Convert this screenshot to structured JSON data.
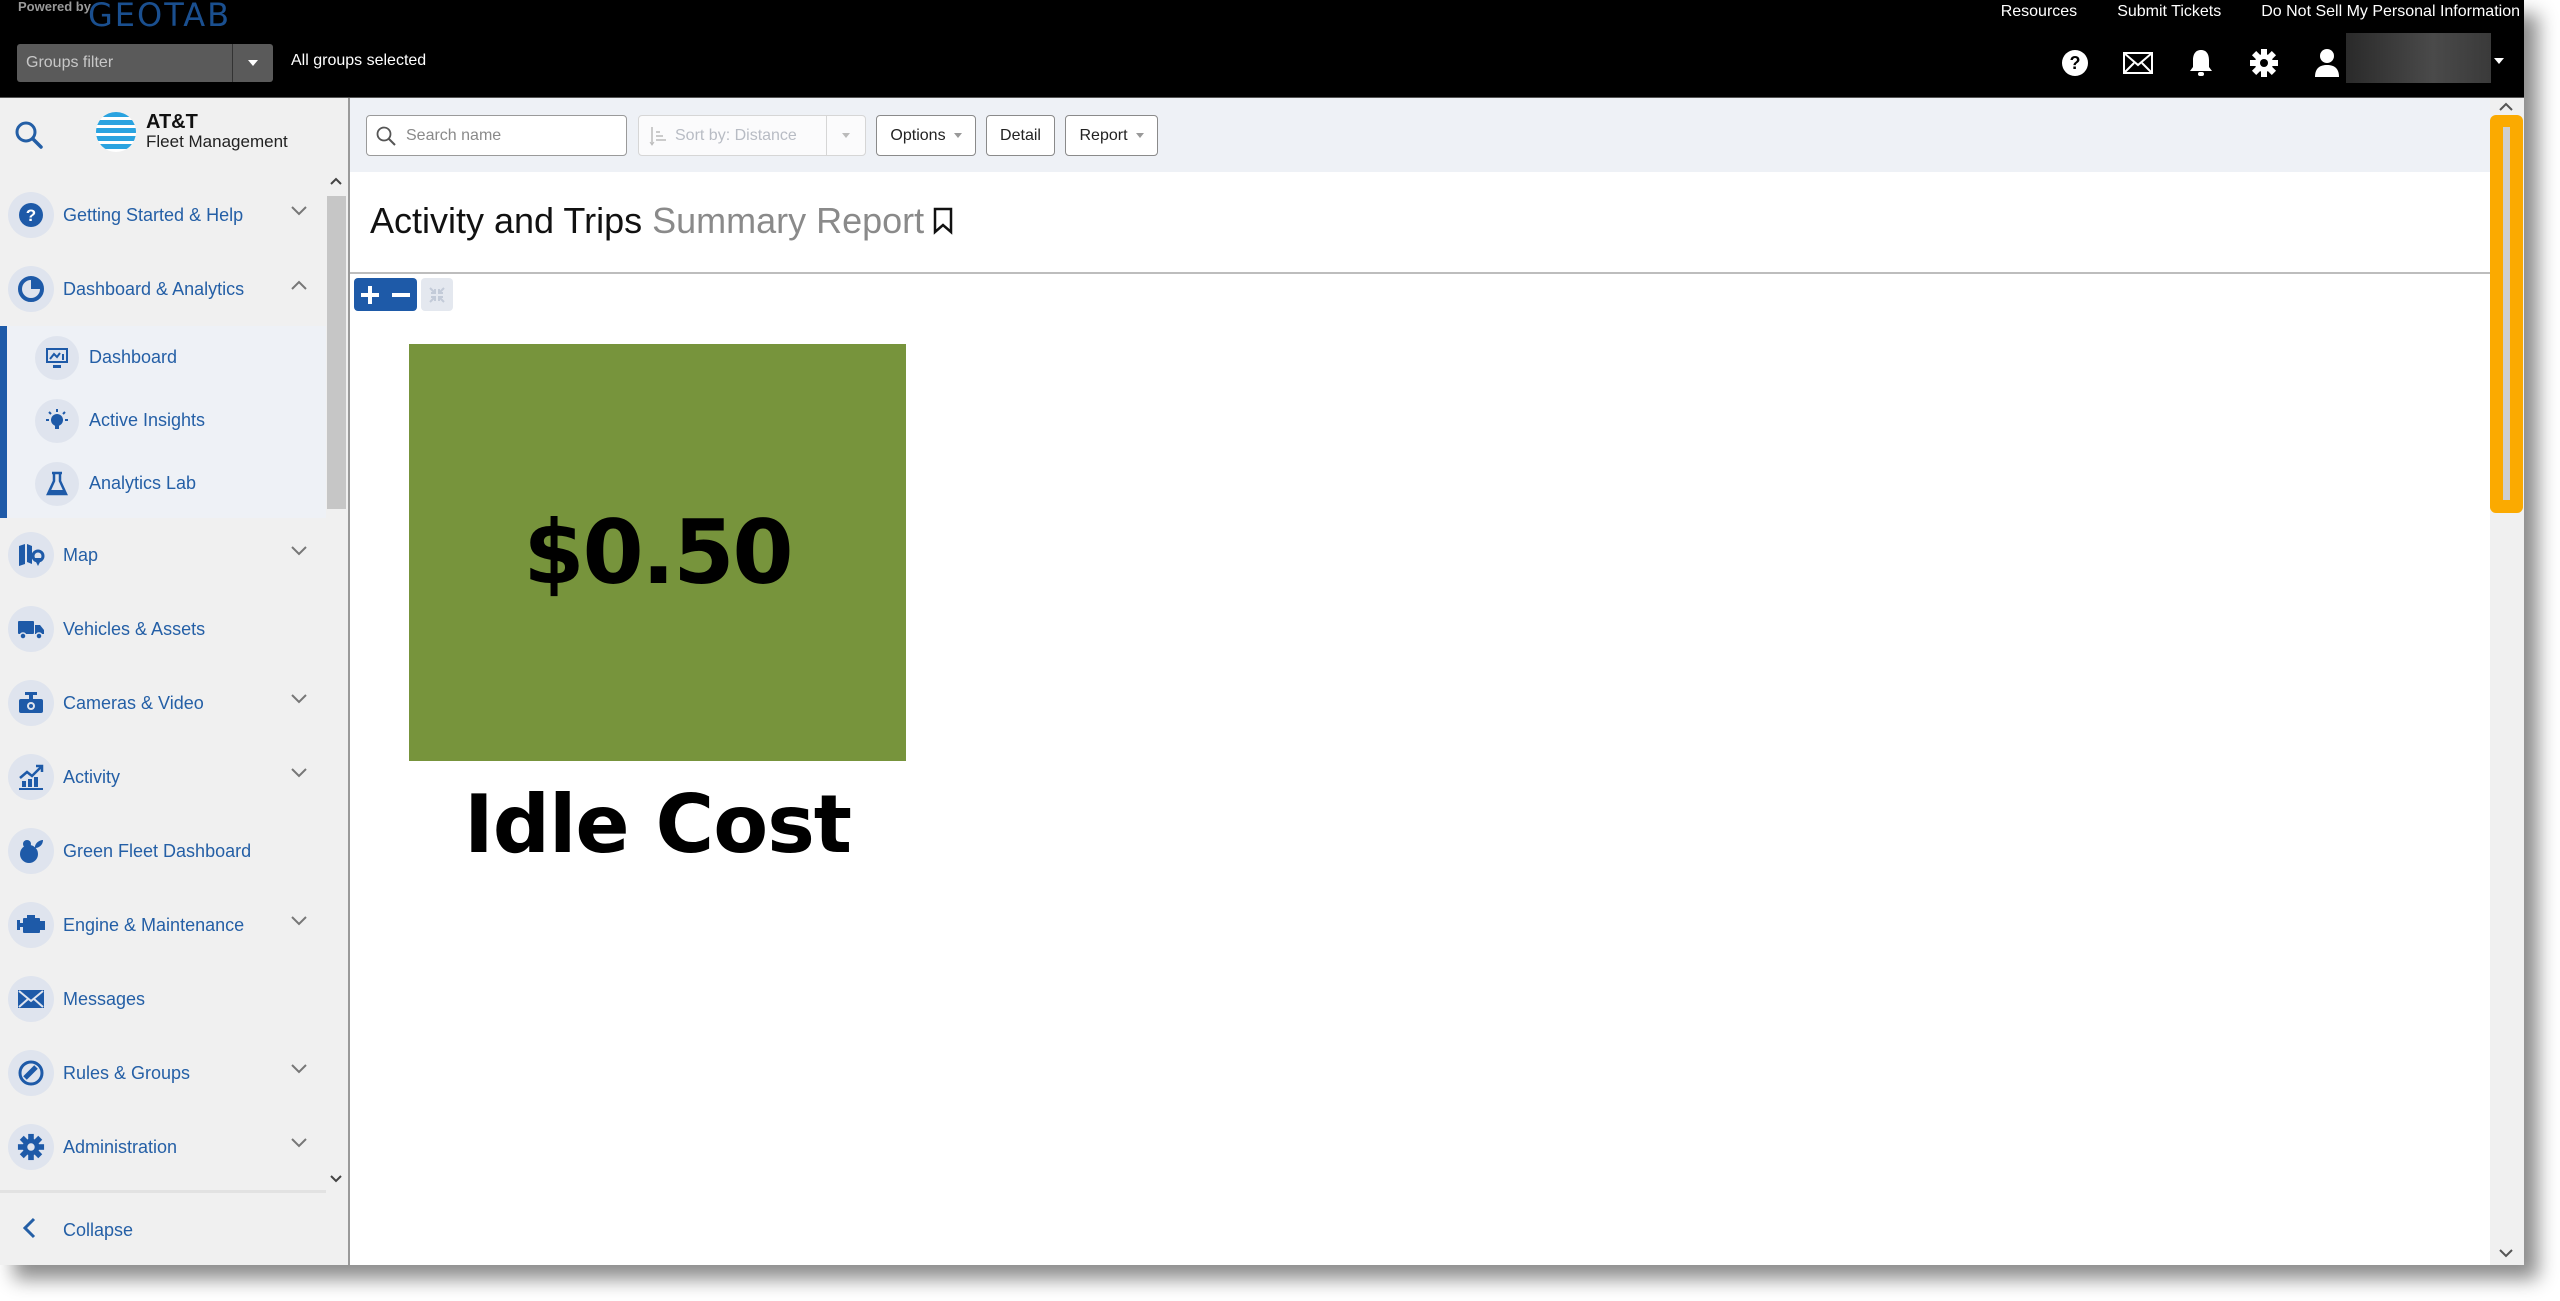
{
  "topbar": {
    "powered_by": "Powered by",
    "brand": "GEOTAB",
    "groups_filter_placeholder": "Groups filter",
    "groups_selected": "All groups selected",
    "links": [
      "Resources",
      "Submit Tickets",
      "Do Not Sell My Personal Information"
    ],
    "icons": [
      "help-icon",
      "mail-icon",
      "bell-icon",
      "gear-icon",
      "user-icon"
    ],
    "user_name": ""
  },
  "sidebar": {
    "brand_line1": "AT&T",
    "brand_line2": "Fleet Management",
    "items": [
      {
        "label": "Getting Started & Help",
        "icon": "help-icon",
        "expandable": true,
        "expanded": false
      },
      {
        "label": "Dashboard & Analytics",
        "icon": "pie-chart-icon",
        "expandable": true,
        "expanded": true
      },
      {
        "label": "Map",
        "icon": "map-icon",
        "expandable": true,
        "expanded": false
      },
      {
        "label": "Vehicles & Assets",
        "icon": "truck-icon",
        "expandable": false
      },
      {
        "label": "Cameras & Video",
        "icon": "camera-icon",
        "expandable": true,
        "expanded": false
      },
      {
        "label": "Activity",
        "icon": "activity-chart-icon",
        "expandable": true,
        "expanded": false
      },
      {
        "label": "Green Fleet Dashboard",
        "icon": "green-fleet-icon",
        "expandable": false
      },
      {
        "label": "Engine & Maintenance",
        "icon": "engine-icon",
        "expandable": true,
        "expanded": false
      },
      {
        "label": "Messages",
        "icon": "mail-icon",
        "expandable": false
      },
      {
        "label": "Rules & Groups",
        "icon": "rules-icon",
        "expandable": true,
        "expanded": false
      },
      {
        "label": "Administration",
        "icon": "gear-icon",
        "expandable": true,
        "expanded": false
      }
    ],
    "subitems": [
      {
        "label": "Dashboard",
        "icon": "monitor-chart-icon"
      },
      {
        "label": "Active Insights",
        "icon": "lightbulb-icon"
      },
      {
        "label": "Analytics Lab",
        "icon": "flask-icon"
      }
    ],
    "collapse_label": "Collapse"
  },
  "toolbar": {
    "search_placeholder": "Search name",
    "sort_label": "Sort by:  Distance",
    "options_label": "Options",
    "detail_label": "Detail",
    "report_label": "Report"
  },
  "page": {
    "title_main": "Activity and Trips",
    "title_sub": "Summary Report"
  },
  "kpi": {
    "value": "$0.50",
    "label": "Idle Cost",
    "tile_color": "#77943c"
  },
  "colors": {
    "accent": "#1e5aa8",
    "nav_text": "#245fa6",
    "highlight": "#fbaa00"
  }
}
